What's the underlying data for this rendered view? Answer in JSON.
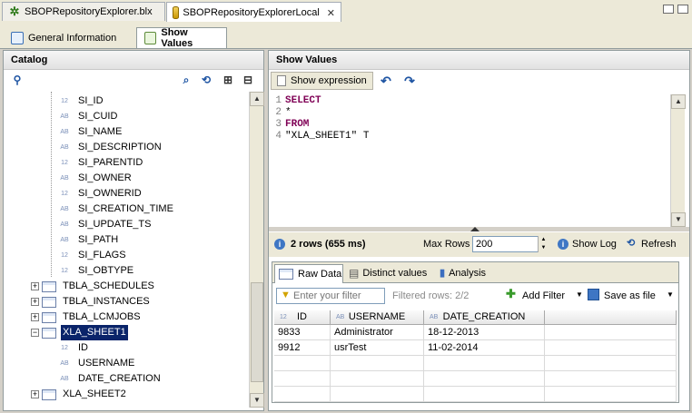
{
  "editor_tabs": [
    {
      "label": "SBOPRepositoryExplorer.blx",
      "icon": "star-icon"
    },
    {
      "label": "SBOPRepositoryExplorerLocal",
      "icon": "database-icon"
    }
  ],
  "sub_tabs": [
    {
      "label": "General Information"
    },
    {
      "label": "Show Values"
    }
  ],
  "catalog": {
    "title": "Catalog",
    "columns": [
      {
        "type": "12",
        "name": "SI_ID"
      },
      {
        "type": "AB",
        "name": "SI_CUID"
      },
      {
        "type": "AB",
        "name": "SI_NAME"
      },
      {
        "type": "AB",
        "name": "SI_DESCRIPTION"
      },
      {
        "type": "12",
        "name": "SI_PARENTID"
      },
      {
        "type": "AB",
        "name": "SI_OWNER"
      },
      {
        "type": "12",
        "name": "SI_OWNERID"
      },
      {
        "type": "AB",
        "name": "SI_CREATION_TIME"
      },
      {
        "type": "AB",
        "name": "SI_UPDATE_TS"
      },
      {
        "type": "AB",
        "name": "SI_PATH"
      },
      {
        "type": "12",
        "name": "SI_FLAGS"
      },
      {
        "type": "12",
        "name": "SI_OBTYPE"
      }
    ],
    "tables_before": [
      "TBLA_SCHEDULES",
      "TBLA_INSTANCES",
      "TBLA_LCMJOBS"
    ],
    "selected_table": "XLA_SHEET1",
    "selected_columns": [
      {
        "type": "12",
        "name": "ID"
      },
      {
        "type": "AB",
        "name": "USERNAME"
      },
      {
        "type": "AB",
        "name": "DATE_CREATION"
      }
    ],
    "tables_after": [
      "XLA_SHEET2"
    ]
  },
  "show_values": {
    "title": "Show Values",
    "show_expression": "Show expression",
    "sql_lines": [
      {
        "n": "1",
        "text": "SELECT",
        "kw": true
      },
      {
        "n": "2",
        "text": "*",
        "kw": false
      },
      {
        "n": "3",
        "text": "FROM",
        "kw": true
      },
      {
        "n": "4",
        "text": "\"XLA_SHEET1\" T",
        "kw": false
      }
    ],
    "status": "2 rows (655 ms)",
    "max_rows_label": "Max Rows",
    "max_rows_value": "200",
    "show_log": "Show Log",
    "refresh": "Refresh"
  },
  "results": {
    "tabs": [
      "Raw Data",
      "Distinct values",
      "Analysis"
    ],
    "filter_placeholder": "Enter your filter",
    "filtered_rows": "Filtered rows: 2/2",
    "add_filter": "Add Filter",
    "save_as_file": "Save as file",
    "headers": [
      {
        "type": "12",
        "name": "ID"
      },
      {
        "type": "AB",
        "name": "USERNAME"
      },
      {
        "type": "AB",
        "name": "DATE_CREATION"
      }
    ],
    "rows": [
      [
        "9833",
        "Administrator",
        "18-12-2013"
      ],
      [
        "9912",
        "usrTest",
        "11-02-2014"
      ]
    ]
  }
}
